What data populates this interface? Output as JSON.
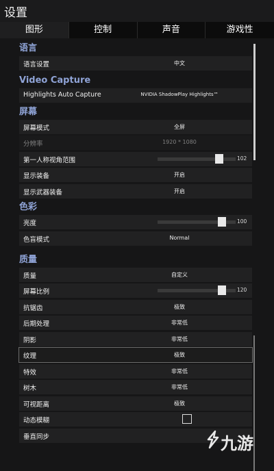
{
  "window": {
    "title": "设置"
  },
  "tabs": [
    {
      "label": "图形",
      "active": true
    },
    {
      "label": "控制",
      "active": false
    },
    {
      "label": "声音",
      "active": false
    },
    {
      "label": "游戏性",
      "active": false
    }
  ],
  "sections": {
    "language": {
      "title": "语言",
      "rows": [
        {
          "label": "语言设置",
          "value": "中文"
        }
      ]
    },
    "video_capture": {
      "title": "Video Capture",
      "rows": [
        {
          "label": "Highlights Auto Capture",
          "value": "NVIDIA ShadowPlay Highlights™"
        }
      ]
    },
    "screen": {
      "title": "屏幕",
      "rows": [
        {
          "label": "屏幕模式",
          "value": "全屏"
        },
        {
          "label": "分辨率",
          "value": "1920 * 1080",
          "disabled": true
        },
        {
          "label": "第一人称视角范围",
          "slider_value": "102",
          "slider_fraction": 0.82
        },
        {
          "label": "显示装备",
          "value": "开启"
        },
        {
          "label": "显示武器装备",
          "value": "开启"
        }
      ]
    },
    "color": {
      "title": "色彩",
      "rows": [
        {
          "label": "亮度",
          "slider_value": "100",
          "slider_fraction": 0.86
        },
        {
          "label": "色盲模式",
          "value": "Normal"
        }
      ]
    },
    "quality": {
      "title": "质量",
      "rows": [
        {
          "label": "质量",
          "value": "自定义"
        },
        {
          "label": "屏幕比例",
          "slider_value": "120",
          "slider_fraction": 0.86
        },
        {
          "label": "抗锯齿",
          "value": "极致"
        },
        {
          "label": "后期处理",
          "value": "非常低"
        },
        {
          "label": "阴影",
          "value": "非常低"
        },
        {
          "label": "纹理",
          "value": "极致",
          "highlight": true
        },
        {
          "label": "特效",
          "value": "非常低"
        },
        {
          "label": "树木",
          "value": "非常低"
        },
        {
          "label": "可视距离",
          "value": "极致"
        },
        {
          "label": "动态模糊",
          "checkbox": false
        },
        {
          "label": "垂直同步"
        }
      ]
    }
  },
  "watermark": {
    "text": "九游",
    "icon": "jiuyou-logo-icon"
  }
}
